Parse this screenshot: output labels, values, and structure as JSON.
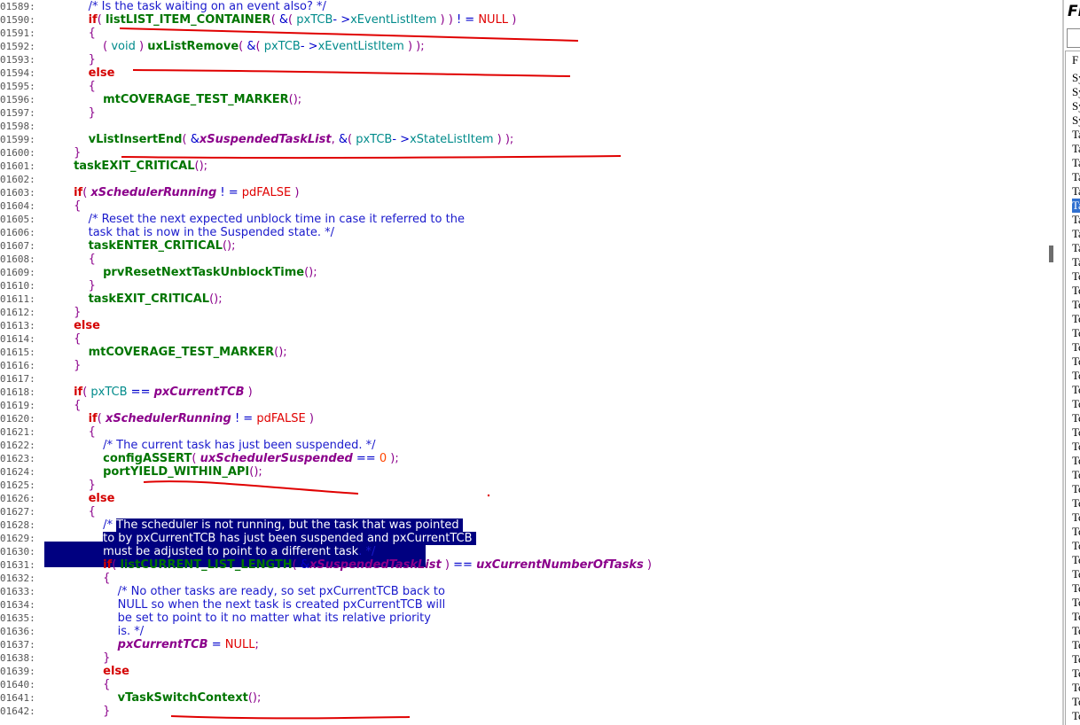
{
  "editor": {
    "lines": [
      {
        "ln": "01589:",
        "seg": [
          {
            "t": "            "
          },
          {
            "c": "cm",
            "t": "/* Is the task waiting on an event also? */"
          }
        ]
      },
      {
        "ln": "01590:",
        "seg": [
          {
            "t": "            "
          },
          {
            "c": "kw",
            "t": "if"
          },
          {
            "c": "br",
            "t": "( "
          },
          {
            "c": "fn",
            "t": "listLIST_ITEM_CONTAINER"
          },
          {
            "c": "br",
            "t": "( "
          },
          {
            "c": "op",
            "t": "&"
          },
          {
            "c": "br",
            "t": "( "
          },
          {
            "c": "mem",
            "t": "pxTCB"
          },
          {
            "c": "op",
            "t": "- >"
          },
          {
            "c": "mem",
            "t": "xEventListItem"
          },
          {
            "c": "br",
            "t": " ) )"
          },
          {
            "t": " "
          },
          {
            "c": "op",
            "t": "! ="
          },
          {
            "t": " "
          },
          {
            "c": "lit",
            "t": "NULL"
          },
          {
            "t": " "
          },
          {
            "c": "br",
            "t": ")"
          }
        ]
      },
      {
        "ln": "01591:",
        "seg": [
          {
            "t": "            "
          },
          {
            "c": "br",
            "t": "{"
          }
        ]
      },
      {
        "ln": "01592:",
        "seg": [
          {
            "t": "                "
          },
          {
            "c": "br",
            "t": "( "
          },
          {
            "c": "mem",
            "t": "void"
          },
          {
            "c": "br",
            "t": " )"
          },
          {
            "t": " "
          },
          {
            "c": "fn",
            "t": "uxListRemove"
          },
          {
            "c": "br",
            "t": "( "
          },
          {
            "c": "op",
            "t": "&"
          },
          {
            "c": "br",
            "t": "( "
          },
          {
            "c": "mem",
            "t": "pxTCB"
          },
          {
            "c": "op",
            "t": "- >"
          },
          {
            "c": "mem",
            "t": "xEventListItem"
          },
          {
            "c": "br",
            "t": " ) );"
          }
        ]
      },
      {
        "ln": "01593:",
        "seg": [
          {
            "t": "            "
          },
          {
            "c": "br",
            "t": "}"
          }
        ]
      },
      {
        "ln": "01594:",
        "seg": [
          {
            "t": "            "
          },
          {
            "c": "kw",
            "t": "else"
          }
        ]
      },
      {
        "ln": "01595:",
        "seg": [
          {
            "t": "            "
          },
          {
            "c": "br",
            "t": "{"
          }
        ]
      },
      {
        "ln": "01596:",
        "seg": [
          {
            "t": "                "
          },
          {
            "c": "fn",
            "t": "mtCOVERAGE_TEST_MARKER"
          },
          {
            "c": "br",
            "t": "();"
          }
        ]
      },
      {
        "ln": "01597:",
        "seg": [
          {
            "t": "            "
          },
          {
            "c": "br",
            "t": "}"
          }
        ]
      },
      {
        "ln": "01598:",
        "seg": []
      },
      {
        "ln": "01599:",
        "seg": [
          {
            "t": "            "
          },
          {
            "c": "fn",
            "t": "vListInsertEnd"
          },
          {
            "c": "br",
            "t": "( "
          },
          {
            "c": "op",
            "t": "&"
          },
          {
            "c": "var",
            "t": "xSuspendedTaskList"
          },
          {
            "c": "br",
            "t": ","
          },
          {
            "t": " "
          },
          {
            "c": "op",
            "t": "&"
          },
          {
            "c": "br",
            "t": "( "
          },
          {
            "c": "mem",
            "t": "pxTCB"
          },
          {
            "c": "op",
            "t": "- >"
          },
          {
            "c": "mem",
            "t": "xStateListItem"
          },
          {
            "c": "br",
            "t": " ) );"
          }
        ]
      },
      {
        "ln": "01600:",
        "seg": [
          {
            "t": "        "
          },
          {
            "c": "br",
            "t": "}"
          }
        ]
      },
      {
        "ln": "01601:",
        "seg": [
          {
            "t": "        "
          },
          {
            "c": "fn",
            "t": "taskEXIT_CRITICAL"
          },
          {
            "c": "br",
            "t": "();"
          }
        ]
      },
      {
        "ln": "01602:",
        "seg": []
      },
      {
        "ln": "01603:",
        "seg": [
          {
            "t": "        "
          },
          {
            "c": "kw",
            "t": "if"
          },
          {
            "c": "br",
            "t": "( "
          },
          {
            "c": "var",
            "t": "xSchedulerRunning"
          },
          {
            "t": " "
          },
          {
            "c": "op",
            "t": "! ="
          },
          {
            "t": " "
          },
          {
            "c": "lit",
            "t": "pdFALSE"
          },
          {
            "c": "br",
            "t": " )"
          }
        ]
      },
      {
        "ln": "01604:",
        "seg": [
          {
            "t": "        "
          },
          {
            "c": "br",
            "t": "{"
          }
        ]
      },
      {
        "ln": "01605:",
        "seg": [
          {
            "t": "            "
          },
          {
            "c": "cm",
            "t": "/* Reset the next expected unblock time in case it referred to the"
          }
        ]
      },
      {
        "ln": "01606:",
        "seg": [
          {
            "t": "            "
          },
          {
            "c": "cm",
            "t": "task that is now in the Suspended state. */"
          }
        ]
      },
      {
        "ln": "01607:",
        "seg": [
          {
            "t": "            "
          },
          {
            "c": "fn",
            "t": "taskENTER_CRITICAL"
          },
          {
            "c": "br",
            "t": "();"
          }
        ]
      },
      {
        "ln": "01608:",
        "seg": [
          {
            "t": "            "
          },
          {
            "c": "br",
            "t": "{"
          }
        ]
      },
      {
        "ln": "01609:",
        "seg": [
          {
            "t": "                "
          },
          {
            "c": "fn",
            "t": "prvResetNextTaskUnblockTime"
          },
          {
            "c": "br",
            "t": "();"
          }
        ]
      },
      {
        "ln": "01610:",
        "seg": [
          {
            "t": "            "
          },
          {
            "c": "br",
            "t": "}"
          }
        ]
      },
      {
        "ln": "01611:",
        "seg": [
          {
            "t": "            "
          },
          {
            "c": "fn",
            "t": "taskEXIT_CRITICAL"
          },
          {
            "c": "br",
            "t": "();"
          }
        ]
      },
      {
        "ln": "01612:",
        "seg": [
          {
            "t": "        "
          },
          {
            "c": "br",
            "t": "}"
          }
        ]
      },
      {
        "ln": "01613:",
        "seg": [
          {
            "t": "        "
          },
          {
            "c": "kw",
            "t": "else"
          }
        ]
      },
      {
        "ln": "01614:",
        "seg": [
          {
            "t": "        "
          },
          {
            "c": "br",
            "t": "{"
          }
        ]
      },
      {
        "ln": "01615:",
        "seg": [
          {
            "t": "            "
          },
          {
            "c": "fn",
            "t": "mtCOVERAGE_TEST_MARKER"
          },
          {
            "c": "br",
            "t": "();"
          }
        ]
      },
      {
        "ln": "01616:",
        "seg": [
          {
            "t": "        "
          },
          {
            "c": "br",
            "t": "}"
          }
        ]
      },
      {
        "ln": "01617:",
        "seg": []
      },
      {
        "ln": "01618:",
        "seg": [
          {
            "t": "        "
          },
          {
            "c": "kw",
            "t": "if"
          },
          {
            "c": "br",
            "t": "( "
          },
          {
            "c": "mem",
            "t": "pxTCB"
          },
          {
            "t": " "
          },
          {
            "c": "op",
            "t": "=="
          },
          {
            "t": " "
          },
          {
            "c": "var",
            "t": "pxCurrentTCB"
          },
          {
            "c": "br",
            "t": " )"
          }
        ]
      },
      {
        "ln": "01619:",
        "seg": [
          {
            "t": "        "
          },
          {
            "c": "br",
            "t": "{"
          }
        ]
      },
      {
        "ln": "01620:",
        "seg": [
          {
            "t": "            "
          },
          {
            "c": "kw",
            "t": "if"
          },
          {
            "c": "br",
            "t": "( "
          },
          {
            "c": "var",
            "t": "xSchedulerRunning"
          },
          {
            "t": " "
          },
          {
            "c": "op",
            "t": "! ="
          },
          {
            "t": " "
          },
          {
            "c": "lit",
            "t": "pdFALSE"
          },
          {
            "c": "br",
            "t": " )"
          }
        ]
      },
      {
        "ln": "01621:",
        "seg": [
          {
            "t": "            "
          },
          {
            "c": "br",
            "t": "{"
          }
        ]
      },
      {
        "ln": "01622:",
        "seg": [
          {
            "t": "                "
          },
          {
            "c": "cm",
            "t": "/* The current task has just been suspended. */"
          }
        ]
      },
      {
        "ln": "01623:",
        "seg": [
          {
            "t": "                "
          },
          {
            "c": "fn",
            "t": "configASSERT"
          },
          {
            "c": "br",
            "t": "( "
          },
          {
            "c": "var",
            "t": "uxSchedulerSuspended"
          },
          {
            "t": " "
          },
          {
            "c": "op",
            "t": "=="
          },
          {
            "t": " "
          },
          {
            "c": "num",
            "t": "0"
          },
          {
            "c": "br",
            "t": " );"
          }
        ]
      },
      {
        "ln": "01624:",
        "seg": [
          {
            "t": "                "
          },
          {
            "c": "fn",
            "t": "portYIELD_WITHIN_API"
          },
          {
            "c": "br",
            "t": "();"
          }
        ]
      },
      {
        "ln": "01625:",
        "seg": [
          {
            "t": "            "
          },
          {
            "c": "br",
            "t": "}"
          }
        ]
      },
      {
        "ln": "01626:",
        "seg": [
          {
            "t": "            "
          },
          {
            "c": "kw",
            "t": "else"
          }
        ]
      },
      {
        "ln": "01627:",
        "seg": [
          {
            "t": "            "
          },
          {
            "c": "br",
            "t": "{"
          }
        ]
      },
      {
        "ln": "01628:",
        "seg": [
          {
            "t": "                "
          },
          {
            "c": "cm",
            "t": "/* "
          },
          {
            "c": "hl",
            "t": "The scheduler is not running, but the task that was pointed "
          }
        ]
      },
      {
        "ln": "01629:",
        "seg": [
          {
            "t": "                "
          },
          {
            "c": "hl",
            "t": "to by pxCurrentTCB has just been suspended and pxCurrentTCB "
          }
        ]
      },
      {
        "ln": "01630:",
        "seg": [
          {
            "t": "                "
          },
          {
            "c": "hl",
            "t": "must be adjusted to point to a different task"
          },
          {
            "c": "cm",
            "t": ". */"
          }
        ]
      },
      {
        "ln": "01631:",
        "seg": [
          {
            "t": "                "
          },
          {
            "c": "kw",
            "t": "if"
          },
          {
            "c": "br",
            "t": "( "
          },
          {
            "c": "fn",
            "t": "listCURRENT_LIST_LENGTH"
          },
          {
            "c": "br",
            "t": "( "
          },
          {
            "c": "op",
            "t": "&"
          },
          {
            "c": "var",
            "t": "xSuspendedTaskList"
          },
          {
            "c": "br",
            "t": " )"
          },
          {
            "t": " "
          },
          {
            "c": "op",
            "t": "=="
          },
          {
            "t": " "
          },
          {
            "c": "var",
            "t": "uxCurrentNumberOfTasks"
          },
          {
            "c": "br",
            "t": " )"
          }
        ]
      },
      {
        "ln": "01632:",
        "seg": [
          {
            "t": "                "
          },
          {
            "c": "br",
            "t": "{"
          }
        ]
      },
      {
        "ln": "01633:",
        "seg": [
          {
            "t": "                    "
          },
          {
            "c": "cm",
            "t": "/* No other tasks are ready, so set pxCurrentTCB back to"
          }
        ]
      },
      {
        "ln": "01634:",
        "seg": [
          {
            "t": "                    "
          },
          {
            "c": "cm",
            "t": "NULL so when the next task is created pxCurrentTCB will"
          }
        ]
      },
      {
        "ln": "01635:",
        "seg": [
          {
            "t": "                    "
          },
          {
            "c": "cm",
            "t": "be set to point to it no matter what its relative priority"
          }
        ]
      },
      {
        "ln": "01636:",
        "seg": [
          {
            "t": "                    "
          },
          {
            "c": "cm",
            "t": "is. */"
          }
        ]
      },
      {
        "ln": "01637:",
        "seg": [
          {
            "t": "                    "
          },
          {
            "c": "var",
            "t": "pxCurrentTCB"
          },
          {
            "t": " "
          },
          {
            "c": "op",
            "t": "="
          },
          {
            "t": " "
          },
          {
            "c": "lit",
            "t": "NULL"
          },
          {
            "c": "br",
            "t": ";"
          }
        ]
      },
      {
        "ln": "01638:",
        "seg": [
          {
            "t": "                "
          },
          {
            "c": "br",
            "t": "}"
          }
        ]
      },
      {
        "ln": "01639:",
        "seg": [
          {
            "t": "                "
          },
          {
            "c": "kw",
            "t": "else"
          }
        ]
      },
      {
        "ln": "01640:",
        "seg": [
          {
            "t": "                "
          },
          {
            "c": "br",
            "t": "{"
          }
        ]
      },
      {
        "ln": "01641:",
        "seg": [
          {
            "t": "                    "
          },
          {
            "c": "fn",
            "t": "vTaskSwitchContext"
          },
          {
            "c": "br",
            "t": "();"
          }
        ]
      },
      {
        "ln": "01642:",
        "seg": [
          {
            "t": "                "
          },
          {
            "c": "br",
            "t": "}"
          }
        ]
      }
    ]
  },
  "side_panel": {
    "title": "Fi",
    "list_header": "F",
    "items": [
      "Sy",
      "Sy",
      "Sy",
      "Sy",
      "Ta",
      "Ta",
      "Ta",
      "Ta",
      "Ta",
      "Ta",
      "Ta",
      "Ta",
      "Ta",
      "Ta",
      "Tc",
      "Tc",
      "Tc",
      "Tc",
      "Tc",
      "Tc",
      "Tc",
      "Tc",
      "Tc",
      "Tc",
      "Tc",
      "Tc",
      "Tc",
      "Tc",
      "Tc",
      "Tc",
      "Tc",
      "Tc",
      "Tc",
      "Tc",
      "Tc",
      "Tc",
      "Tc",
      "Tc",
      "Tc",
      "Tc",
      "Tc",
      "Tc",
      "Tc",
      "Tc",
      "Tc",
      "Tc",
      "Tc"
    ],
    "selected_index": 9
  },
  "colors": {
    "annotation": "#e00000",
    "selection": "#000080"
  }
}
